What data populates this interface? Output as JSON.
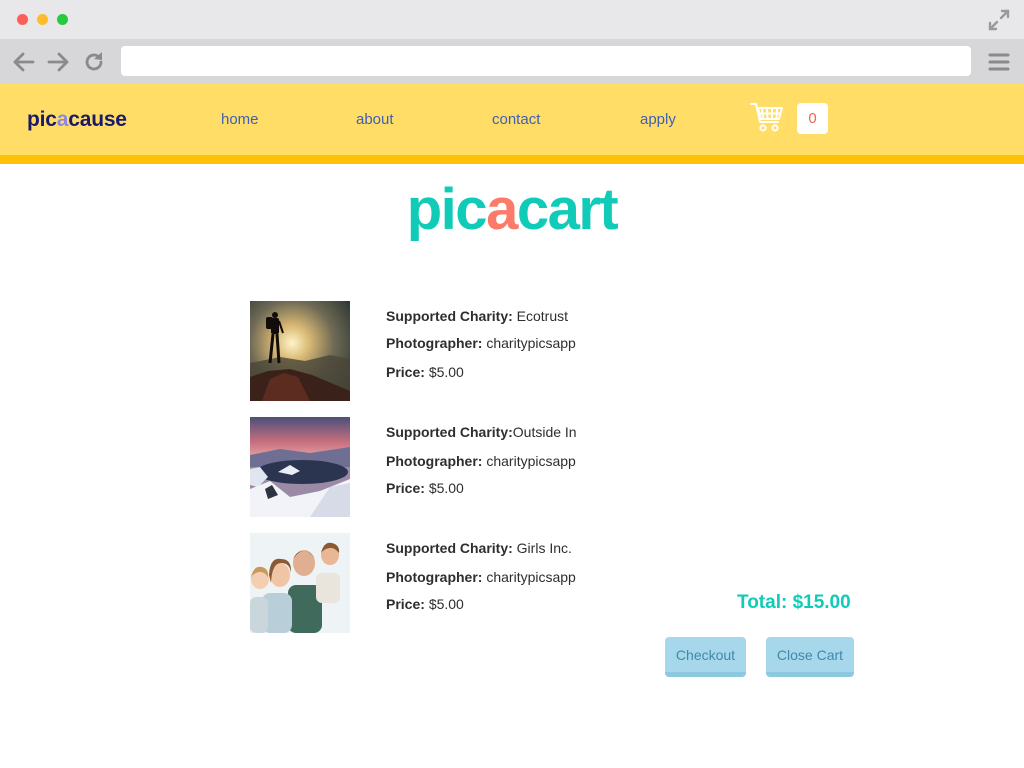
{
  "browser": {
    "url": "",
    "colors": {
      "close": "#fc5f57",
      "minimize": "#fdbc2e",
      "maximize": "#29c840"
    },
    "icons": [
      "arrow-left-icon",
      "arrow-right-icon",
      "reload-icon",
      "expand-icon",
      "hamburger-menu-icon"
    ]
  },
  "header": {
    "logo_prefix": "pic",
    "logo_accent": "a",
    "logo_suffix": "cause",
    "nav": [
      {
        "label": "home"
      },
      {
        "label": "about"
      },
      {
        "label": "contact"
      },
      {
        "label": "apply"
      }
    ],
    "cart_count": "0",
    "colors": {
      "background": "#ffdd67",
      "stripe": "#ffc107",
      "link": "#3f60b5"
    }
  },
  "page": {
    "title_prefix": "pic",
    "title_accent": "a",
    "title_suffix": "cart",
    "colors": {
      "title": "#10cbb8",
      "title_accent": "#fc7a6a"
    }
  },
  "cart": {
    "labels": {
      "charity": "Supported Charity:",
      "photographer": "Photographer:",
      "price": "Price:"
    },
    "items": [
      {
        "charity": "Ecotrust",
        "photographer": "charitypicsapp",
        "price": "$5.00",
        "image": "hiker-on-mountain-at-sunset"
      },
      {
        "charity": "Outside In",
        "photographer": "charitypicsapp",
        "price": "$5.00",
        "image": "snowy-crater-lake-at-dusk"
      },
      {
        "charity": "Girls Inc.",
        "photographer": "charitypicsapp",
        "price": "$5.00",
        "image": "smiling-family-portrait"
      }
    ],
    "total": "Total: $15.00",
    "checkout_label": "Checkout",
    "close_label": "Close Cart"
  }
}
